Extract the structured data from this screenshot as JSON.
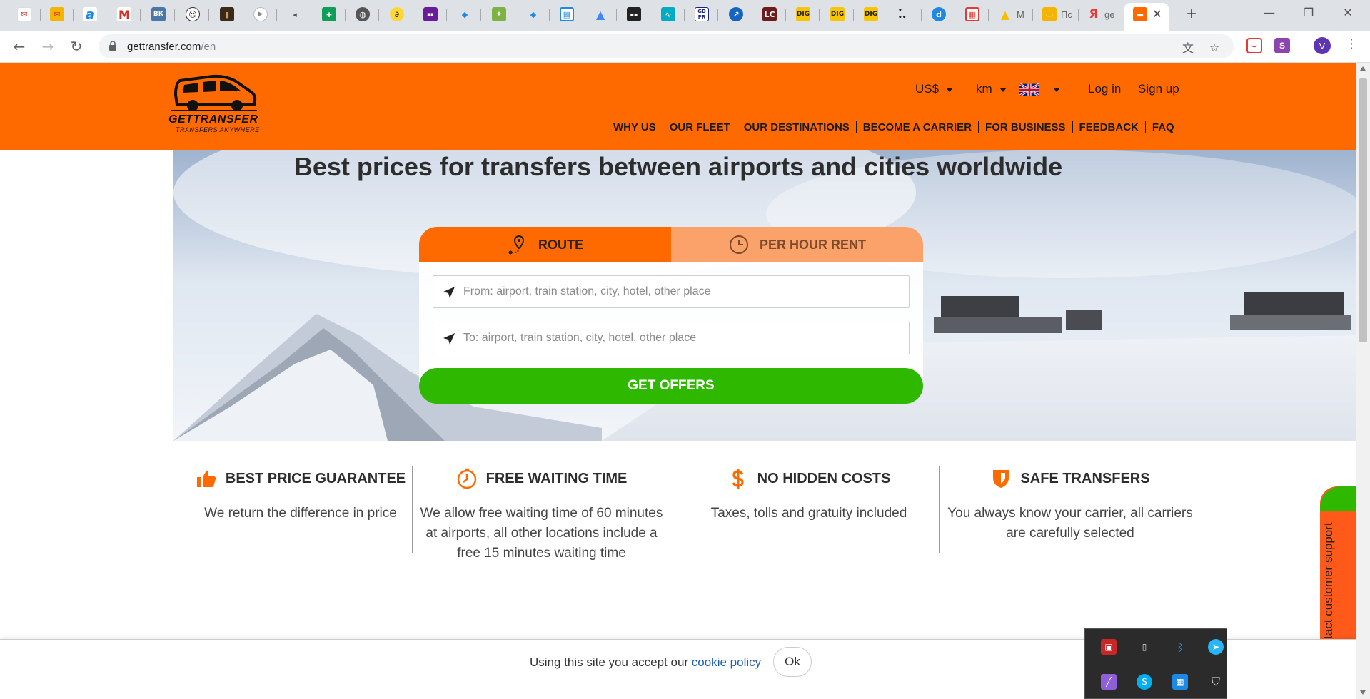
{
  "browser": {
    "tab_titles": [
      "М",
      "Пс",
      "ge"
    ],
    "url_host": "gettransfer.com",
    "url_path": "/en",
    "profile_initial": "V",
    "pinned_tab_labels": [
      "a",
      "M",
      "ВК",
      "LC",
      "DIG",
      "DIG",
      "DIG",
      "GD PR"
    ]
  },
  "header": {
    "logo_text": "GETTRANSFER",
    "logo_tagline": "TRANSFERS ANYWHERE",
    "currency": "US$",
    "units": "km",
    "login": "Log in",
    "signup": "Sign up",
    "nav": [
      "WHY US",
      "OUR FLEET",
      "OUR DESTINATIONS",
      "BECOME A CARRIER",
      "FOR BUSINESS",
      "FEEDBACK",
      "FAQ"
    ]
  },
  "hero": {
    "title": "Best prices for transfers between airports and cities worldwide",
    "tab_route": "ROUTE",
    "tab_hourly": "PER HOUR RENT",
    "from_placeholder": "From: airport, train station, city, hotel, other place",
    "to_placeholder": "To: airport, train station, city, hotel, other place",
    "cta": "GET OFFERS"
  },
  "features": [
    {
      "title": "BEST PRICE GUARANTEE",
      "desc": "We return the difference in price",
      "icon": "thumbs-up-icon"
    },
    {
      "title": "FREE WAITING TIME",
      "desc": "We allow free waiting time of 60 minutes at airports, all other locations include a free 15 minutes waiting time",
      "icon": "clock-icon"
    },
    {
      "title": "NO HIDDEN COSTS",
      "desc": "Taxes, tolls and gratuity included",
      "icon": "dollar-icon"
    },
    {
      "title": "SAFE TRANSFERS",
      "desc": "You always know your carrier, all carriers are carefully selected",
      "icon": "shield-icon"
    }
  ],
  "cookie": {
    "text": "Using this site you accept our",
    "link": "cookie policy",
    "ok": "Ok"
  },
  "support": {
    "label": "Contact customer support"
  },
  "colors": {
    "brand_orange": "#ff6a00",
    "tab_inactive": "#fba26a",
    "cta_green": "#2eb800"
  }
}
